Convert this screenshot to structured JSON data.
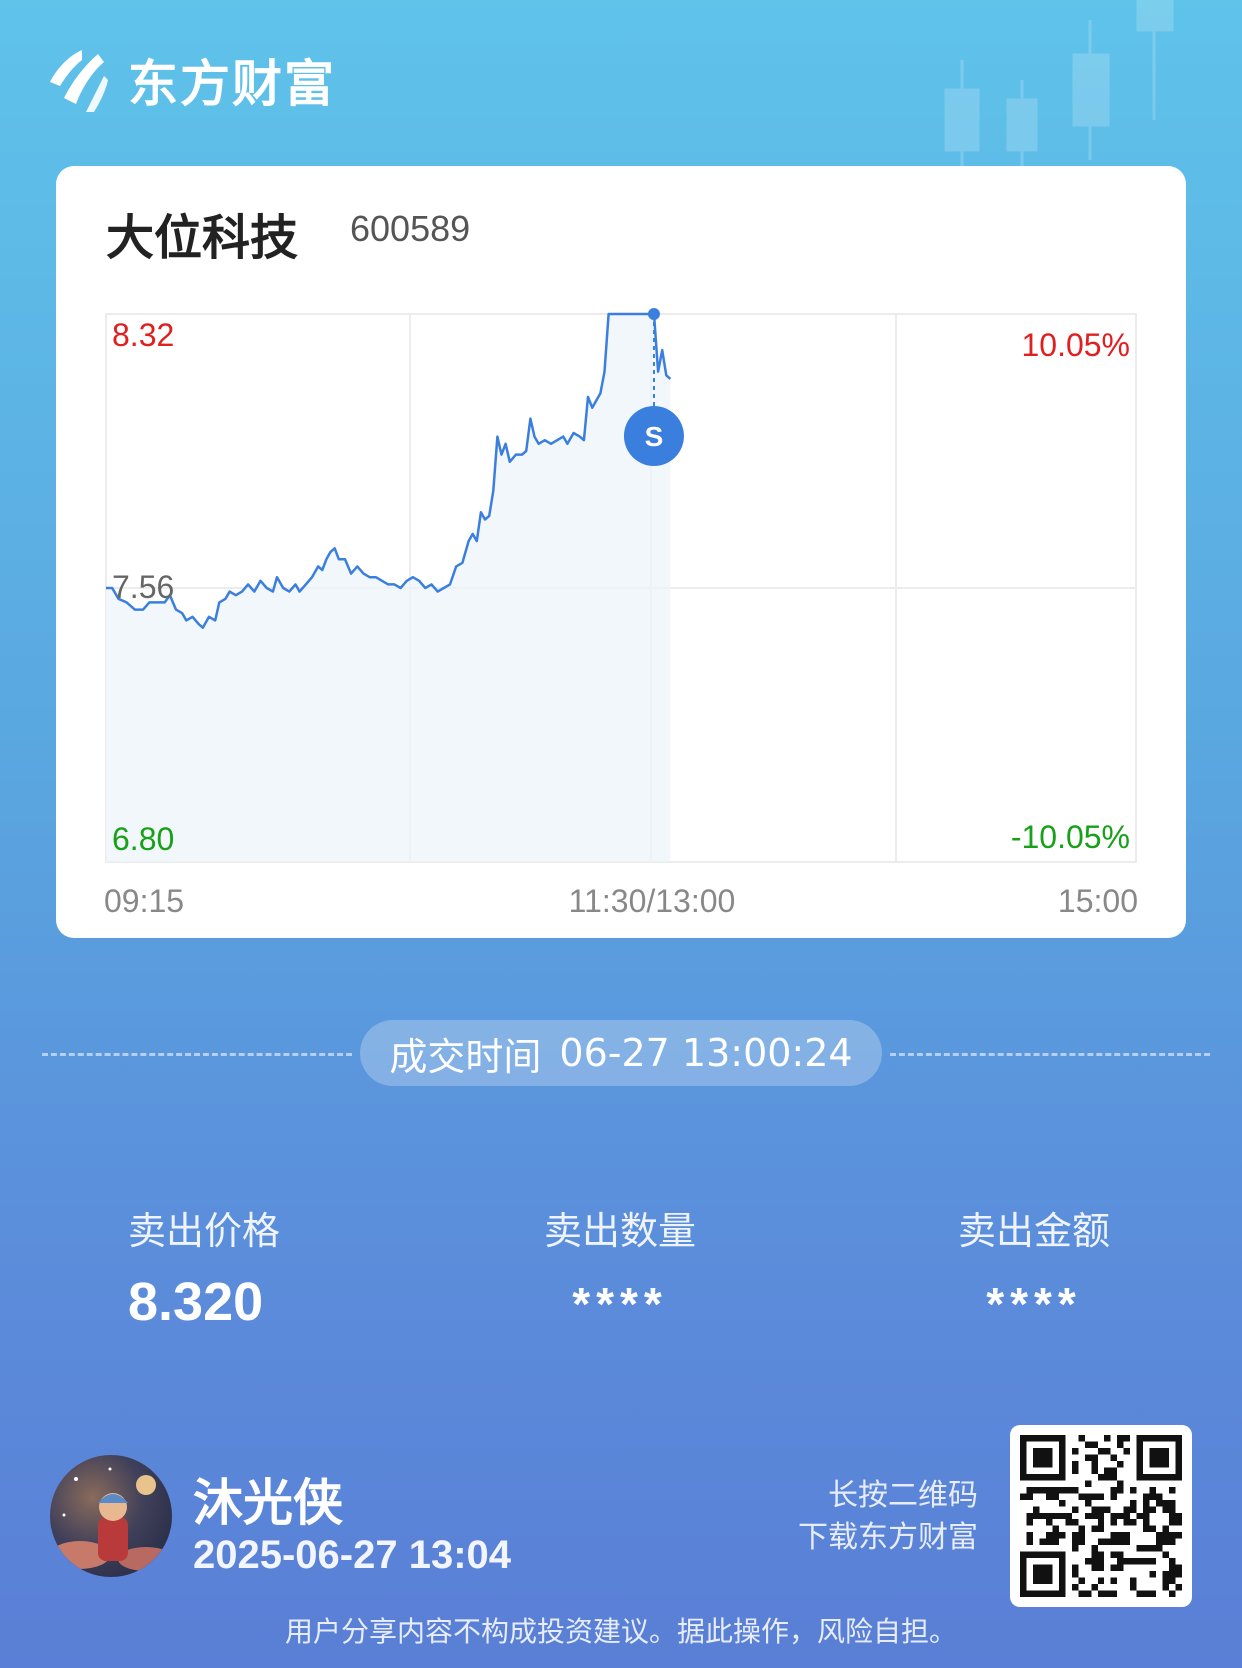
{
  "brand": {
    "name": "东方财富",
    "logo_icon": "eastmoney-logo-icon"
  },
  "stock": {
    "name": "大位科技",
    "code": "600589"
  },
  "chart_data": {
    "type": "line",
    "title": "",
    "x_ticks": [
      "09:15",
      "11:30/13:00",
      "15:00"
    ],
    "y_left_ticks": [
      "8.32",
      "7.56",
      "6.80"
    ],
    "y_right_ticks": [
      "10.05%",
      "-10.05%"
    ],
    "ylim": [
      6.8,
      8.32
    ],
    "base_price": 7.56,
    "colors": {
      "line": "#3b7fde",
      "up": "#e02020",
      "down": "#18a018",
      "neutral": "#666666"
    },
    "marker": {
      "label": "S",
      "x": 0.532,
      "y": 8.32
    },
    "series": [
      {
        "values": [
          [
            0.0,
            7.56
          ],
          [
            0.006,
            7.56
          ],
          [
            0.012,
            7.53
          ],
          [
            0.02,
            7.52
          ],
          [
            0.028,
            7.5
          ],
          [
            0.036,
            7.5
          ],
          [
            0.042,
            7.52
          ],
          [
            0.05,
            7.52
          ],
          [
            0.057,
            7.52
          ],
          [
            0.062,
            7.54
          ],
          [
            0.068,
            7.5
          ],
          [
            0.074,
            7.49
          ],
          [
            0.078,
            7.47
          ],
          [
            0.084,
            7.48
          ],
          [
            0.09,
            7.46
          ],
          [
            0.094,
            7.45
          ],
          [
            0.1,
            7.48
          ],
          [
            0.106,
            7.47
          ],
          [
            0.11,
            7.52
          ],
          [
            0.116,
            7.53
          ],
          [
            0.12,
            7.55
          ],
          [
            0.126,
            7.54
          ],
          [
            0.132,
            7.55
          ],
          [
            0.138,
            7.57
          ],
          [
            0.144,
            7.55
          ],
          [
            0.15,
            7.58
          ],
          [
            0.156,
            7.56
          ],
          [
            0.162,
            7.55
          ],
          [
            0.166,
            7.59
          ],
          [
            0.172,
            7.56
          ],
          [
            0.178,
            7.55
          ],
          [
            0.184,
            7.57
          ],
          [
            0.188,
            7.55
          ],
          [
            0.194,
            7.57
          ],
          [
            0.2,
            7.59
          ],
          [
            0.206,
            7.62
          ],
          [
            0.21,
            7.61
          ],
          [
            0.214,
            7.64
          ],
          [
            0.218,
            7.66
          ],
          [
            0.222,
            7.67
          ],
          [
            0.226,
            7.64
          ],
          [
            0.232,
            7.64
          ],
          [
            0.238,
            7.6
          ],
          [
            0.244,
            7.62
          ],
          [
            0.25,
            7.6
          ],
          [
            0.256,
            7.59
          ],
          [
            0.262,
            7.59
          ],
          [
            0.268,
            7.58
          ],
          [
            0.274,
            7.57
          ],
          [
            0.28,
            7.57
          ],
          [
            0.286,
            7.56
          ],
          [
            0.292,
            7.58
          ],
          [
            0.298,
            7.59
          ],
          [
            0.304,
            7.58
          ],
          [
            0.31,
            7.56
          ],
          [
            0.316,
            7.57
          ],
          [
            0.322,
            7.55
          ],
          [
            0.328,
            7.56
          ],
          [
            0.334,
            7.57
          ],
          [
            0.34,
            7.62
          ],
          [
            0.346,
            7.63
          ],
          [
            0.352,
            7.69
          ],
          [
            0.356,
            7.71
          ],
          [
            0.36,
            7.69
          ],
          [
            0.364,
            7.77
          ],
          [
            0.368,
            7.75
          ],
          [
            0.372,
            7.76
          ],
          [
            0.376,
            7.83
          ],
          [
            0.38,
            7.98
          ],
          [
            0.384,
            7.93
          ],
          [
            0.388,
            7.96
          ],
          [
            0.392,
            7.91
          ],
          [
            0.398,
            7.93
          ],
          [
            0.404,
            7.93
          ],
          [
            0.408,
            7.94
          ],
          [
            0.412,
            8.03
          ],
          [
            0.416,
            7.98
          ],
          [
            0.42,
            7.96
          ],
          [
            0.426,
            7.97
          ],
          [
            0.432,
            7.96
          ],
          [
            0.438,
            7.97
          ],
          [
            0.444,
            7.98
          ],
          [
            0.448,
            7.96
          ],
          [
            0.454,
            7.99
          ],
          [
            0.46,
            7.98
          ],
          [
            0.464,
            7.97
          ],
          [
            0.468,
            8.09
          ],
          [
            0.472,
            8.06
          ],
          [
            0.476,
            8.08
          ],
          [
            0.48,
            8.1
          ],
          [
            0.484,
            8.16
          ],
          [
            0.488,
            8.32
          ],
          [
            0.496,
            8.32
          ],
          [
            0.504,
            8.32
          ],
          [
            0.512,
            8.32
          ],
          [
            0.52,
            8.32
          ],
          [
            0.526,
            8.32
          ],
          [
            0.532,
            8.32
          ],
          [
            0.536,
            8.16
          ],
          [
            0.54,
            8.22
          ],
          [
            0.544,
            8.15
          ],
          [
            0.548,
            8.14
          ]
        ]
      }
    ]
  },
  "trade": {
    "time_label": "成交时间",
    "time_value": "06-27 13:00:24"
  },
  "stats": [
    {
      "label": "卖出价格",
      "value": "8.320"
    },
    {
      "label": "卖出数量",
      "value": "****"
    },
    {
      "label": "卖出金额",
      "value": "****"
    }
  ],
  "user": {
    "name": "沐光侠",
    "datetime": "2025-06-27 13:04"
  },
  "qr": {
    "hint_line1": "长按二维码",
    "hint_line2": "下载东方财富"
  },
  "disclaimer": "用户分享内容不构成投资建议。据此操作，风险自担。"
}
